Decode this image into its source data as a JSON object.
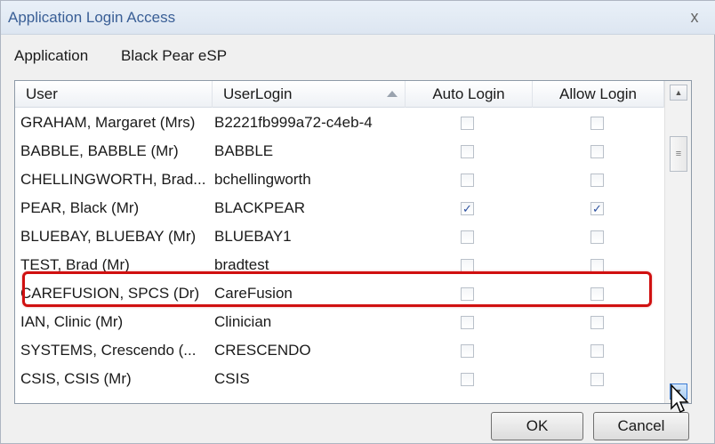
{
  "window": {
    "title": "Application Login Access",
    "close_glyph": "x"
  },
  "application": {
    "label": "Application",
    "value": "Black Pear eSP"
  },
  "table": {
    "columns": [
      "User",
      "UserLogin",
      "Auto Login",
      "Allow Login"
    ],
    "sorted_column": "UserLogin",
    "sort_direction": "ascending",
    "rows": [
      {
        "user": "GRAHAM, Margaret (Mrs)",
        "login": "B2221fb999a72-c4eb-4",
        "auto_login": false,
        "allow_login": false
      },
      {
        "user": "BABBLE, BABBLE (Mr)",
        "login": "BABBLE",
        "auto_login": false,
        "allow_login": false
      },
      {
        "user": "CHELLINGWORTH, Brad...",
        "login": "bchellingworth",
        "auto_login": false,
        "allow_login": false
      },
      {
        "user": "PEAR, Black (Mr)",
        "login": "BLACKPEAR",
        "auto_login": true,
        "allow_login": true
      },
      {
        "user": "BLUEBAY, BLUEBAY (Mr)",
        "login": "BLUEBAY1",
        "auto_login": false,
        "allow_login": false
      },
      {
        "user": "TEST, Brad (Mr)",
        "login": "bradtest",
        "auto_login": false,
        "allow_login": false
      },
      {
        "user": "CAREFUSION, SPCS (Dr)",
        "login": "CareFusion",
        "auto_login": false,
        "allow_login": false
      },
      {
        "user": "IAN, Clinic (Mr)",
        "login": "Clinician",
        "auto_login": false,
        "allow_login": false
      },
      {
        "user": "SYSTEMS, Crescendo (...",
        "login": "CRESCENDO",
        "auto_login": false,
        "allow_login": false
      },
      {
        "user": "CSIS, CSIS (Mr)",
        "login": "CSIS",
        "auto_login": false,
        "allow_login": false
      }
    ],
    "highlighted_row": "PEAR, Black (Mr)"
  },
  "buttons": {
    "ok": "OK",
    "cancel": "Cancel"
  },
  "colors": {
    "highlight_border": "#d01010",
    "title_text": "#3a5f96"
  }
}
